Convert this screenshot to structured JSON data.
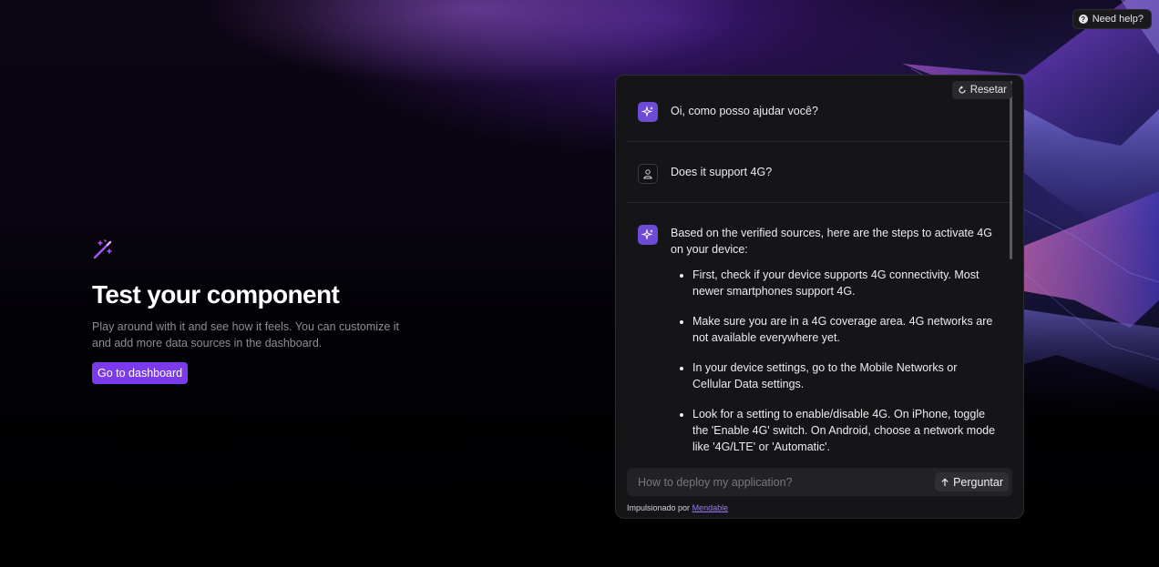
{
  "help": {
    "label": "Need help?",
    "icon": "question-circle-icon"
  },
  "hero": {
    "icon": "magic-wand-icon",
    "title": "Test your component",
    "description": "Play around with it and see how it feels. You can customize it and add more data sources in the dashboard.",
    "button_label": "Go to dashboard"
  },
  "chat": {
    "reset_label": "Resetar",
    "messages": [
      {
        "role": "assistant",
        "text": "Oi, como posso ajudar você?"
      },
      {
        "role": "user",
        "text": "Does it support 4G?"
      },
      {
        "role": "assistant",
        "text": "Based on the verified sources, here are the steps to activate 4G on your device:",
        "steps": [
          "First, check if your device supports 4G connectivity. Most newer smartphones support 4G.",
          "Make sure you are in a 4G coverage area. 4G networks are not available everywhere yet.",
          "In your device settings, go to the Mobile Networks or Cellular Data settings.",
          "Look for a setting to enable/disable 4G. On iPhone, toggle the 'Enable 4G' switch. On Android, choose a network mode like '4G/LTE' or 'Automatic'."
        ]
      }
    ],
    "input": {
      "placeholder": "How to deploy my application?",
      "value": ""
    },
    "ask_label": "Perguntar",
    "powered_prefix": "Impulsionado por",
    "powered_link": "Mendable"
  },
  "colors": {
    "accent": "#7c3aed",
    "panel_bg": "#151517"
  }
}
